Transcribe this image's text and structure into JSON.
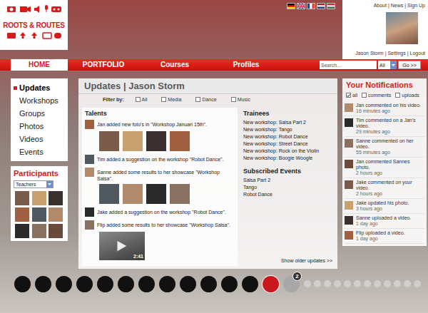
{
  "logo": {
    "title": "ROOTS & ROUTES"
  },
  "flags": [
    {
      "kind": "de"
    },
    {
      "kind": "gb"
    },
    {
      "kind": "fr"
    },
    {
      "kind": "nl"
    },
    {
      "kind": "hu"
    }
  ],
  "separator": "|",
  "top_links": [
    "About",
    "News",
    "Sign Up"
  ],
  "user": {
    "name": "Jason Storm",
    "links": [
      "Settings",
      "Logout"
    ]
  },
  "nav": {
    "tabs": [
      {
        "label": "HOME",
        "selected": true
      },
      {
        "label": "PORTFOLIO",
        "selected": false
      },
      {
        "label": "Courses",
        "selected": false
      },
      {
        "label": "Profiles",
        "selected": false
      }
    ]
  },
  "search": {
    "placeholder": "Search...",
    "scope": "All",
    "button": "Go >>"
  },
  "sidebar": {
    "items": [
      {
        "label": "Updates",
        "selected": true
      },
      {
        "label": "Workshops",
        "selected": false
      },
      {
        "label": "Groups",
        "selected": false
      },
      {
        "label": "Photos",
        "selected": false
      },
      {
        "label": "Videos",
        "selected": false
      },
      {
        "label": "Events",
        "selected": false
      }
    ]
  },
  "participants": {
    "title": "Participants",
    "filter": "Teachers"
  },
  "updates": {
    "title": "Updates | Jason Storm",
    "filter": {
      "label": "Filter by:",
      "options": [
        {
          "label": "All",
          "checked": false
        },
        {
          "label": "Media",
          "checked": false
        },
        {
          "label": "Dance",
          "checked": false
        },
        {
          "label": "Music",
          "checked": false
        }
      ]
    },
    "talents": {
      "title": "Talents",
      "items": [
        {
          "text": "Jan added new foto's in \"Workshop Januari 15th\".",
          "media": [
            {
              "kind": "photo"
            },
            {
              "kind": "photo"
            },
            {
              "kind": "photo"
            },
            {
              "kind": "photo"
            }
          ]
        },
        {
          "text": "Tim added a suggestion on the workshop \"Robot Dance\".",
          "media": []
        },
        {
          "text": "Sanne added some results to her showcase \"Workshop Salsa\".",
          "media": [
            {
              "kind": "photo"
            },
            {
              "kind": "photo"
            },
            {
              "kind": "photo"
            },
            {
              "kind": "photo"
            }
          ]
        },
        {
          "text": "Jake added a suggestion on the workshop \"Robot Dance\".",
          "media": []
        },
        {
          "text": "Flip added some results to her showcase \"Workshop Salsa\".",
          "media": [
            {
              "kind": "video",
              "duration": "2:41"
            }
          ]
        }
      ]
    },
    "trainees": {
      "title": "Trainees",
      "items": [
        "New workshop: Salsa Part 2",
        "New workshop: Tango",
        "New workshop: Robot Dance",
        "New workshop: Street Dance",
        "New workshop: Rock on the Violin",
        "New workshop: Boogie Woogle"
      ]
    },
    "events": {
      "title": "Subscribed Events",
      "items": [
        "Salsa Part 2",
        "Tango",
        "Robot Dance"
      ]
    },
    "more": "Show older updates >>"
  },
  "notifications": {
    "title": "Your Notifications",
    "filters": [
      {
        "label": "all",
        "checked": true
      },
      {
        "label": "comments",
        "checked": false
      },
      {
        "label": "uploads",
        "checked": false
      }
    ],
    "items": [
      {
        "text": "Jan commented on his video.",
        "time": "16 minutes ago"
      },
      {
        "text": "Tim commented on a Jan's video.",
        "time": "29 minutes ago"
      },
      {
        "text": "Sanne commented on her video.",
        "time": "55 minutes ago"
      },
      {
        "text": "Jan commented Sannes photo.",
        "time": "2 hours ago"
      },
      {
        "text": "Jake commented on your video.",
        "time": "2 hours ago"
      },
      {
        "text": "Jake updated his photo.",
        "time": "3 hours ago"
      },
      {
        "text": "Sanne uploaded a video.",
        "time": "1 day ago"
      },
      {
        "text": "Flip uploaded a video.",
        "time": "1 day ago"
      }
    ]
  },
  "timeline": {
    "dots": [
      {
        "kind": "past",
        "selected": false
      },
      {
        "kind": "past",
        "selected": false
      },
      {
        "kind": "past",
        "selected": false
      },
      {
        "kind": "past",
        "selected": false
      },
      {
        "kind": "past",
        "selected": false
      },
      {
        "kind": "past",
        "selected": false
      },
      {
        "kind": "past",
        "selected": false
      },
      {
        "kind": "past",
        "selected": false
      },
      {
        "kind": "past",
        "selected": false
      },
      {
        "kind": "past",
        "selected": false
      },
      {
        "kind": "past",
        "selected": false
      },
      {
        "kind": "past",
        "selected": false
      },
      {
        "kind": "current",
        "selected": true
      },
      {
        "kind": "next",
        "selected": false,
        "badge": "2"
      },
      {
        "kind": "future",
        "selected": false
      },
      {
        "kind": "future",
        "selected": false
      },
      {
        "kind": "future",
        "selected": false
      },
      {
        "kind": "future",
        "selected": false
      },
      {
        "kind": "future",
        "selected": false
      },
      {
        "kind": "future",
        "selected": false
      },
      {
        "kind": "future",
        "selected": false
      },
      {
        "kind": "future",
        "selected": false
      },
      {
        "kind": "future",
        "selected": false
      },
      {
        "kind": "future",
        "selected": false
      },
      {
        "kind": "future",
        "selected": false
      },
      {
        "kind": "future",
        "selected": false
      }
    ]
  }
}
